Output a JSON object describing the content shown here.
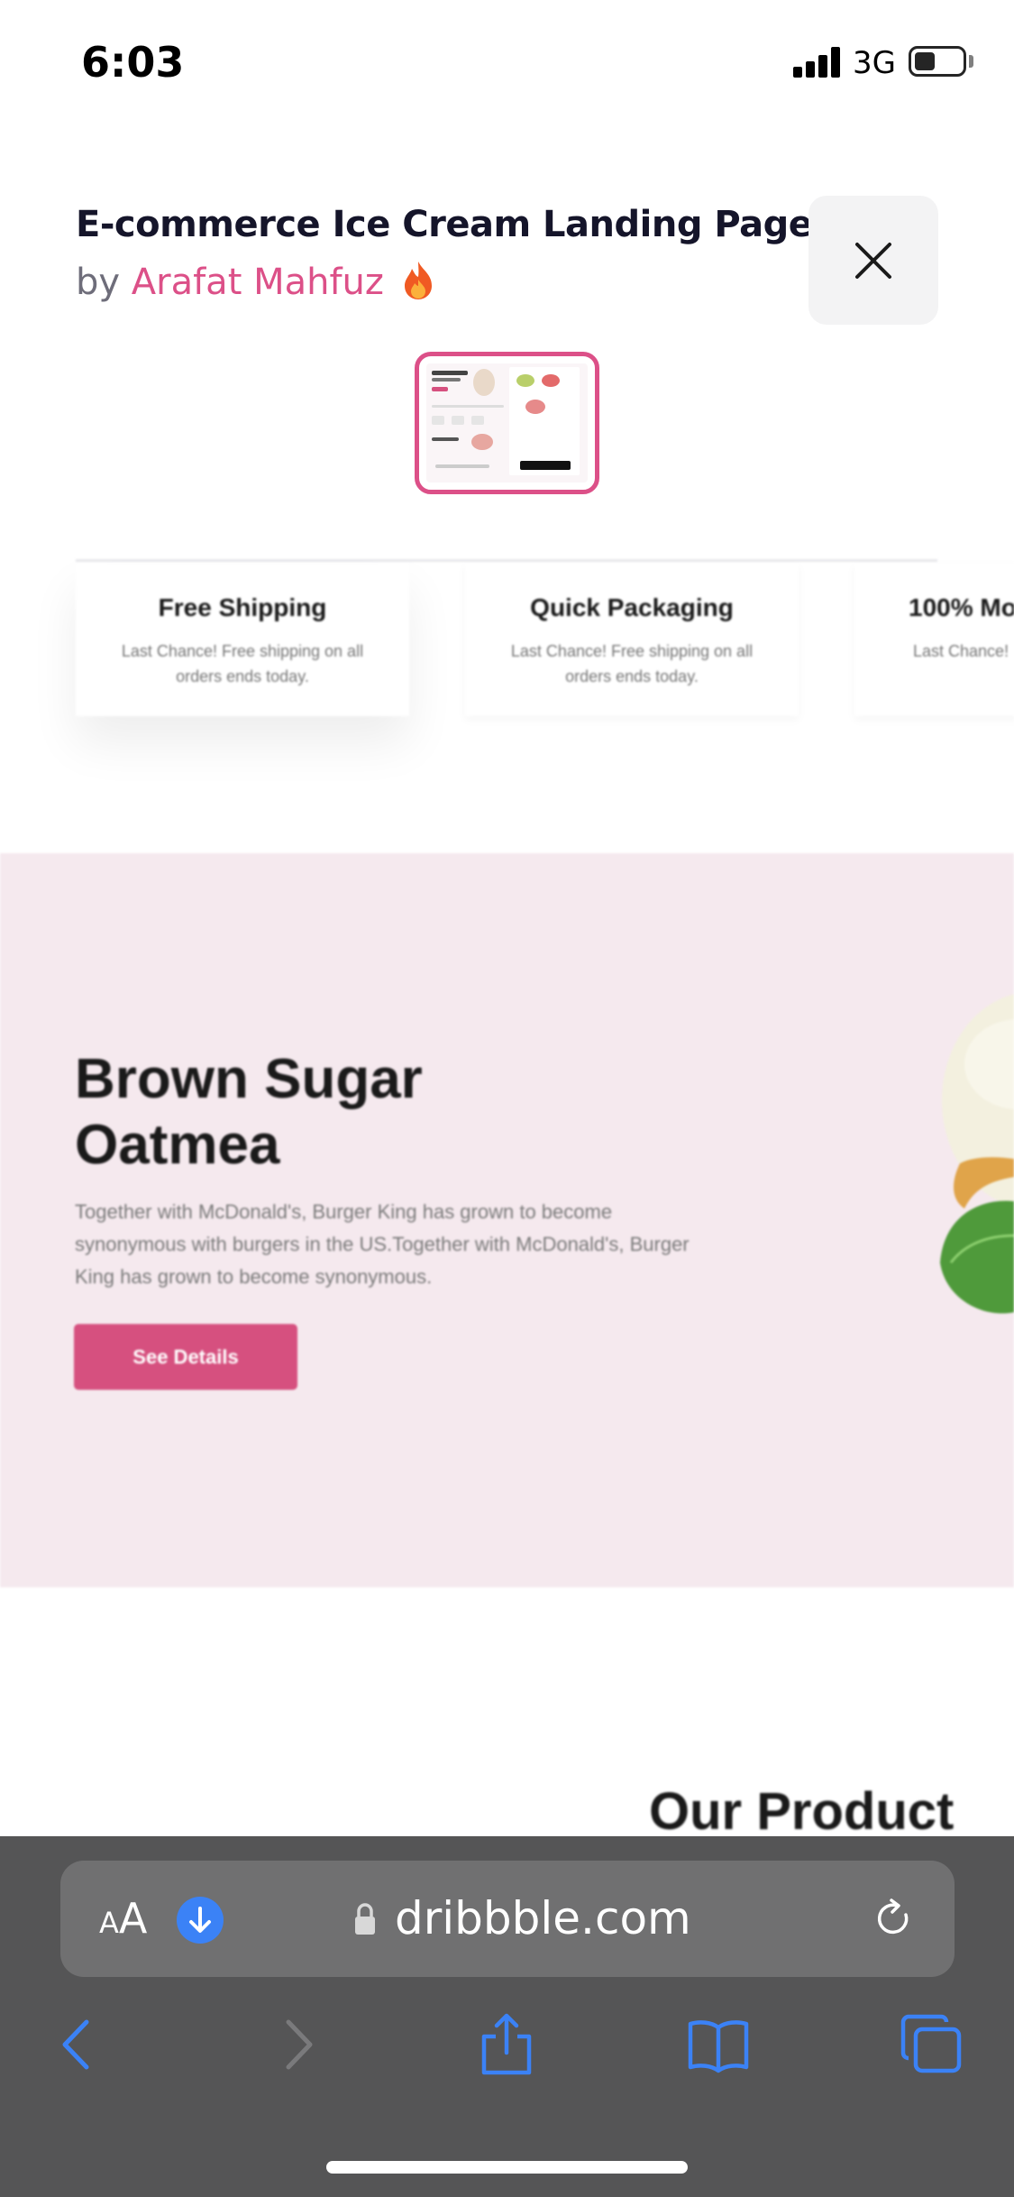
{
  "status_bar": {
    "time": "6:03",
    "network": "3G",
    "icons": [
      "signal-icon",
      "battery-icon"
    ]
  },
  "shot": {
    "title": "E-commerce Ice Cream Landing Page",
    "by_prefix": "by",
    "author": "Arafat Mahfuz",
    "author_icon": "fire-icon",
    "close_icon": "close-icon"
  },
  "features": [
    {
      "title": "Free Shipping",
      "desc": "Last Chance! Free shipping on all orders ends today."
    },
    {
      "title": "Quick Packaging",
      "desc": "Last Chance! Free shipping on all orders ends today."
    },
    {
      "title": "100% Mo",
      "desc": "Last Chance! Fr orders e"
    }
  ],
  "hero": {
    "title": "Brown Sugar Oatmea",
    "desc": "Together with McDonald's, Burger King has grown to become synonymous with burgers in the US.Together with McDonald's, Burger King has grown to become synonymous.",
    "button": "See Details"
  },
  "section_heading": "Our Product",
  "browser": {
    "aa_label_small": "A",
    "aa_label_big": "A",
    "url": "dribbble.com",
    "icons": [
      "download-icon",
      "lock-icon",
      "reload-icon",
      "back-icon",
      "forward-icon",
      "share-icon",
      "bookmarks-icon",
      "tabs-icon"
    ]
  },
  "colors": {
    "accent": "#dc5088",
    "hero_bg": "#f5e9ee",
    "button_bg": "#d6507f",
    "toolbar_bg": "#555556",
    "link_blue": "#3b82f6"
  }
}
